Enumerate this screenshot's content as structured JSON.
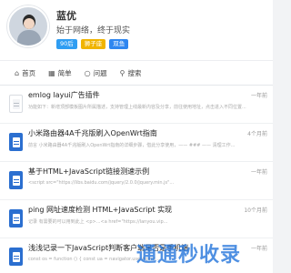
{
  "profile": {
    "name": "蓝优",
    "motto": "始于网络，终于现实",
    "badges": [
      "90后",
      "狮子座",
      "双鱼"
    ]
  },
  "nav": [
    {
      "icon": "home-icon",
      "label": "首页"
    },
    {
      "icon": "grid-icon",
      "label": "简单"
    },
    {
      "icon": "quote-icon",
      "label": "问题"
    },
    {
      "icon": "search-icon",
      "label": "搜索"
    }
  ],
  "articles": [
    {
      "title": "emlog layui广告插件",
      "date": "一年前",
      "excerpt": "功能如下：新增顶部模板图片所属描述，支持管理上线最新内容及分享，前往使用地址，点击进入不同位置..."
    },
    {
      "title": "小米路由器4A千兆版刷入OpenWrt指南",
      "date": "4个月前",
      "excerpt": "前言 小米路由器4A千兆版刷入OpenWrt指南的详细步骤，借此分享使用，—— ### —— 清理工作..."
    },
    {
      "title": "基于HTML+JavaScript链接测速示例",
      "date": "一年前",
      "excerpt": "<script src=\"https://libs.baidu.com/jquery/2.0.0/jquery.min.js\"..."
    },
    {
      "title": "ping 网址速度检测 HTML+JavaScript 实现",
      "date": "10个月前",
      "excerpt": "记录 有需要的可以用到此上 <p>...<a href=\"https://lanyou.vip..."
    },
    {
      "title": "浅浅记录一下JavaScript判断客户端是否是手机端",
      "date": "一年前",
      "excerpt": "const os = function () { const ua = navigator.userAgent..."
    }
  ],
  "watermark": "通通秒收录"
}
